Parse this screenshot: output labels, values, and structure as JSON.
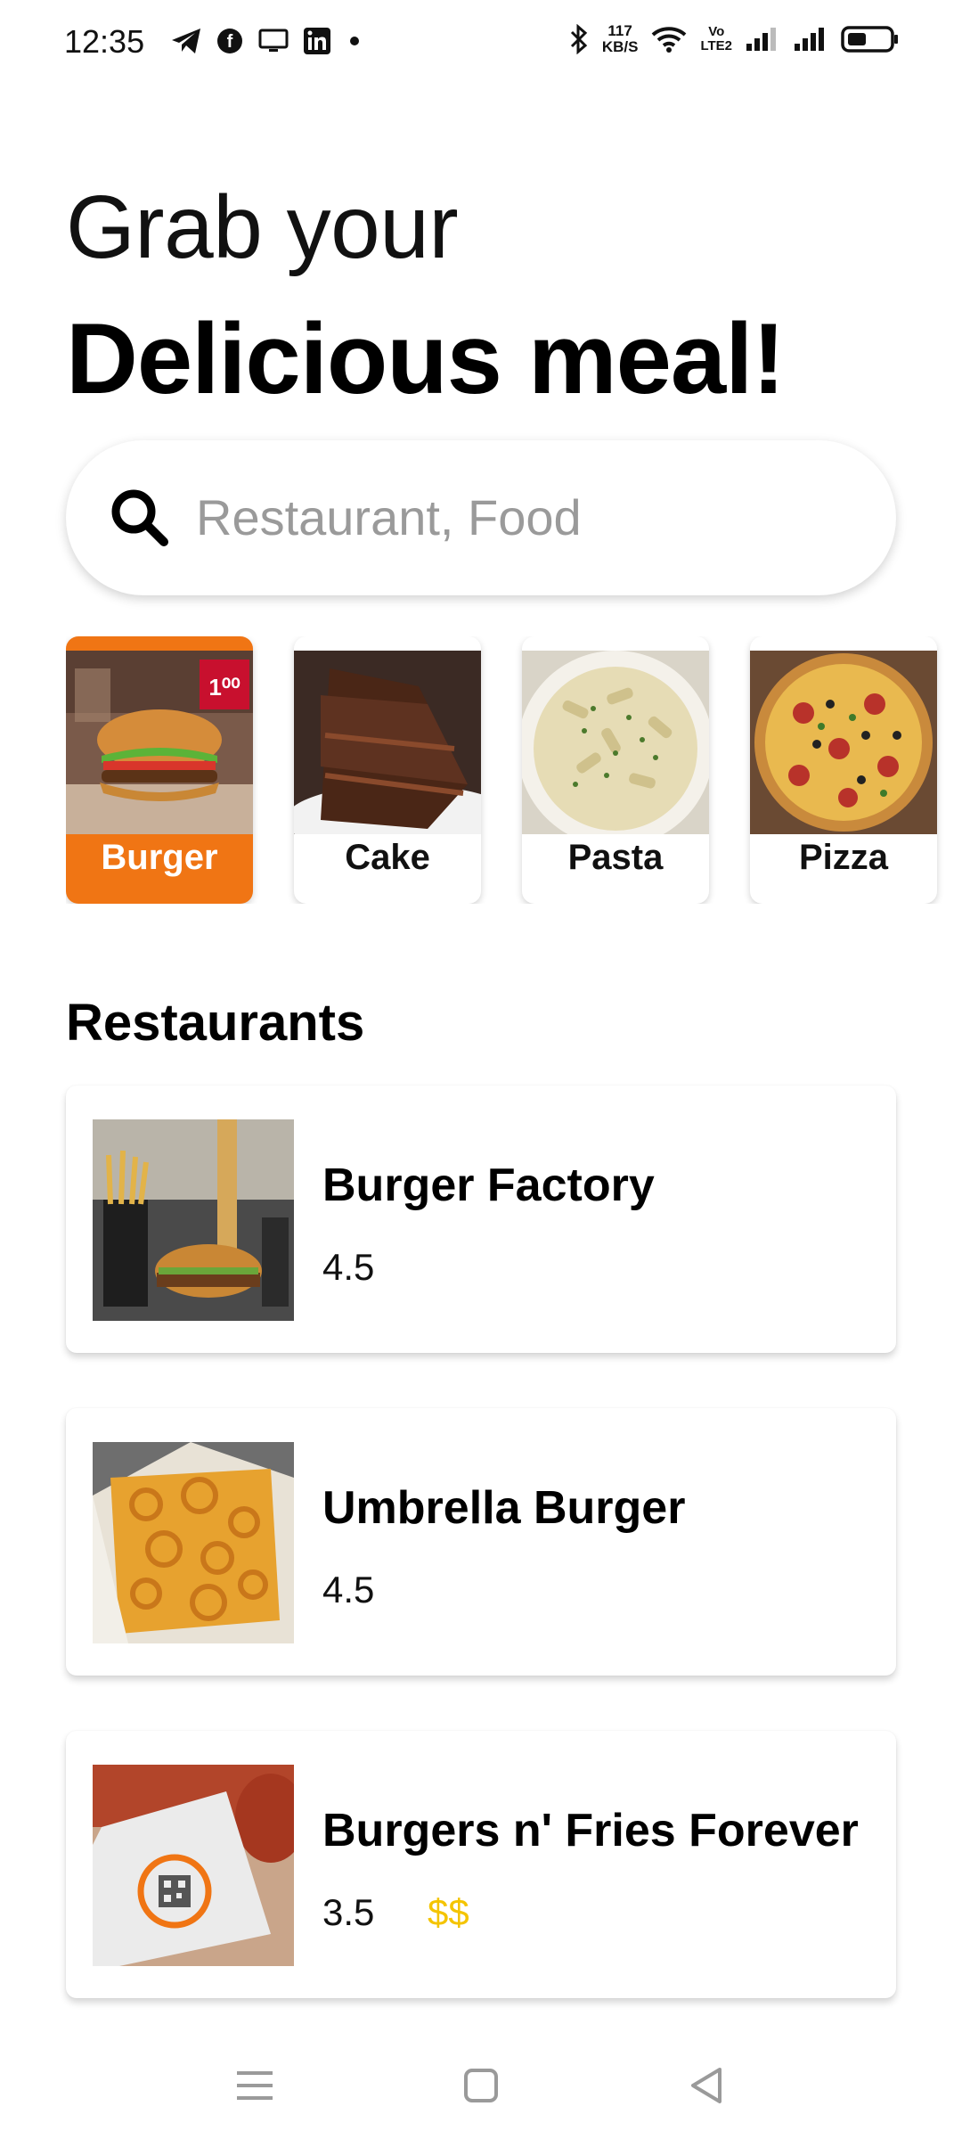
{
  "status_bar": {
    "time": "12:35",
    "left_icons": [
      "telegram-icon",
      "f-circle-icon",
      "monitor-icon",
      "linkedin-icon",
      "dot-icon"
    ],
    "speed_value": "117",
    "speed_unit": "KB/S",
    "volte_line1": "Vo",
    "volte_line2": "LTE2",
    "right_icons": [
      "bluetooth-icon",
      "wifi-icon",
      "signal-icon",
      "signal-icon",
      "battery-icon"
    ]
  },
  "header": {
    "line1": "Grab your",
    "line2": "Delicious meal!"
  },
  "search": {
    "placeholder": "Restaurant, Food",
    "value": ""
  },
  "categories": [
    {
      "label": "Burger",
      "selected": true,
      "icon": "burger-image"
    },
    {
      "label": "Cake",
      "selected": false,
      "icon": "cake-image"
    },
    {
      "label": "Pasta",
      "selected": false,
      "icon": "pasta-image"
    },
    {
      "label": "Pizza",
      "selected": false,
      "icon": "pizza-image"
    }
  ],
  "burger_badge": "1⁰⁰",
  "section_title": "Restaurants",
  "restaurants": [
    {
      "name": "Burger Factory",
      "rating": "4.5",
      "price": ""
    },
    {
      "name": "Umbrella Burger",
      "rating": "4.5",
      "price": ""
    },
    {
      "name": "Burgers n' Fries Forever",
      "rating": "3.5",
      "price": "$$"
    }
  ],
  "nav_bar": {
    "icons": [
      "menu-icon",
      "home-square-icon",
      "back-triangle-icon"
    ]
  },
  "colors": {
    "accent": "#f07514",
    "price": "#f4c400",
    "placeholder": "#9a9a9a"
  }
}
